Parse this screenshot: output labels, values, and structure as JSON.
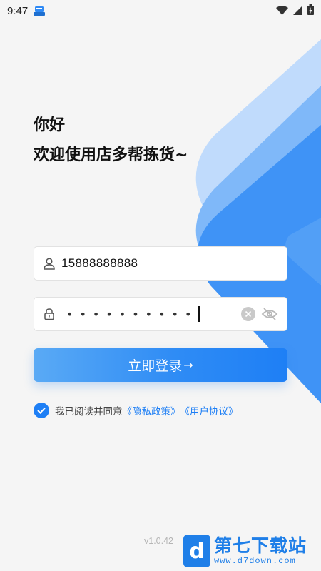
{
  "status_bar": {
    "time": "9:47",
    "app_icon": "app-notification-icon",
    "icons": [
      "wifi-icon",
      "signal-icon",
      "battery-icon"
    ]
  },
  "greeting": {
    "line1": "你好",
    "line2": "欢迎使用店多帮拣货~"
  },
  "form": {
    "username": {
      "icon": "user-icon",
      "value": "15888888888"
    },
    "password": {
      "icon": "lock-icon",
      "masked_value": "••••••••••",
      "clear_icon": "clear-icon",
      "visibility_icon": "eye-off-icon"
    },
    "login_button": {
      "label": "立即登录",
      "arrow": "→"
    }
  },
  "agreement": {
    "checked": true,
    "prefix": "我已阅读并同意",
    "privacy_link": "《隐私政策》",
    "terms_link": "《用户协议》"
  },
  "version": "v1.0.42",
  "watermark": {
    "logo_letter": "d",
    "title": "第七下载站",
    "url": "www.d7down.com"
  },
  "colors": {
    "accent": "#1e7ff5",
    "background": "#f5f5f5",
    "shape_light": "#bcd8fb",
    "shape_mid": "#4c9cf6",
    "shape_dark": "#2f8af5"
  }
}
